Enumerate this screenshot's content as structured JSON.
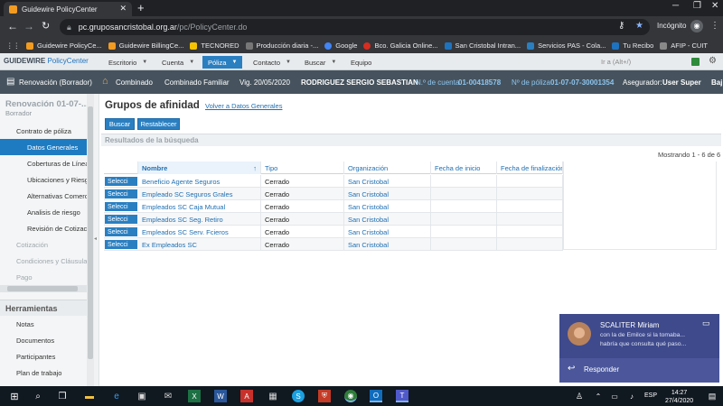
{
  "browser": {
    "tab_title": "Guidewire PolicyCenter",
    "url_host": "pc.gruposancristobal.org.ar",
    "url_path": "/pc/PolicyCenter.do",
    "incognito_label": "Incógnito",
    "bookmarks": [
      {
        "label": "Guidewire PolicyCe...",
        "color": "#f29b21"
      },
      {
        "label": "Guidewire BillingCe...",
        "color": "#f29b21"
      },
      {
        "label": "TECNORED",
        "color": "#f5c400"
      },
      {
        "label": "Producción diaria -...",
        "color": "#3a3a3a"
      },
      {
        "label": "Google",
        "color": "#4285f4"
      },
      {
        "label": "Bco. Galicia Online...",
        "color": "#d62d20"
      },
      {
        "label": "San Cristobal Intran...",
        "color": "#1e73be"
      },
      {
        "label": "Servicios PAS - Cola...",
        "color": "#2a7fc1"
      },
      {
        "label": "Tu Recibo",
        "color": "#1e73be"
      },
      {
        "label": "AFIP - CUIT",
        "color": "#888888"
      }
    ]
  },
  "app": {
    "logo_brand": "GUIDEWIRE",
    "logo_product": "PolicyCenter",
    "menu": [
      {
        "label": "Escritorio"
      },
      {
        "label": "Cuenta"
      },
      {
        "label": "Póliza",
        "selected": true
      },
      {
        "label": "Contacto"
      },
      {
        "label": "Buscar"
      },
      {
        "label": "Equipo"
      }
    ],
    "search_placeholder": "Ir a (Alt+/)",
    "info": {
      "renewal": "Renovación (Borrador)",
      "product": "Combinado",
      "product_type": "Combinado Familiar",
      "effective": "Vig. 20/05/2020",
      "insured": "RODRIGUEZ SERGIO SEBASTIAN",
      "account_label": "N.º de cuenta",
      "account_number": "01-00418578",
      "policy_label": "Nº de póliza",
      "policy_number": "01-07-07-30001354",
      "underwriter_label": "Asegurador:",
      "underwriter": "User Super",
      "extra": "Baj"
    }
  },
  "sidebar": {
    "title": "Renovación 01-07-...",
    "subtitle": "Borrador",
    "items": [
      {
        "label": "Contrato de póliza",
        "indent": 1
      },
      {
        "label": "Datos Generales",
        "indent": 2,
        "selected": true
      },
      {
        "label": "Coberturas de Línea",
        "indent": 2
      },
      {
        "label": "Ubicaciones y Riesgo",
        "indent": 2
      },
      {
        "label": "Alternativas Comerci",
        "indent": 2
      },
      {
        "label": "Analisis de riesgo",
        "indent": 2
      },
      {
        "label": "Revisión de Cotizació",
        "indent": 2
      },
      {
        "label": "Cotización",
        "indent": 1,
        "dim": true
      },
      {
        "label": "Condiciones y Cláusulas",
        "indent": 1,
        "dim": true
      },
      {
        "label": "Pago",
        "indent": 1,
        "dim": true
      }
    ],
    "tools_heading": "Herramientas",
    "tools": [
      "Notas",
      "Documentos",
      "Participantes",
      "Plan de trabajo"
    ]
  },
  "main": {
    "title": "Grupos de afinidad",
    "back_link": "Volver a Datos Generales",
    "buttons": [
      "Buscar",
      "Restablecer"
    ],
    "results_heading": "Resultados de la búsqueda",
    "showing": "Mostrando 1 - 6 de 6",
    "columns": [
      "Nombre",
      "Tipo",
      "Organización",
      "Fecha de inicio",
      "Fecha de finalización"
    ],
    "select_label": "Selecci",
    "rows": [
      [
        "Beneficio Agente Seguros",
        "Cerrado",
        "San Cristobal",
        "",
        ""
      ],
      [
        "Empleado SC Seguros Grales",
        "Cerrado",
        "San Cristobal",
        "",
        ""
      ],
      [
        "Empleados SC Caja Mutual",
        "Cerrado",
        "San Cristobal",
        "",
        ""
      ],
      [
        "Empleados SC Seg. Retiro",
        "Cerrado",
        "San Cristobal",
        "",
        ""
      ],
      [
        "Empleados SC Serv. Fcieros",
        "Cerrado",
        "San Cristobal",
        "",
        ""
      ],
      [
        "Ex Empleados SC",
        "Cerrado",
        "San Cristobal",
        "",
        ""
      ]
    ]
  },
  "chat": {
    "name": "SCALITER Miriam",
    "line1": "con la de Emilce si la tomaba...",
    "line2": "habría que consulta qué paso...",
    "reply": "Responder"
  },
  "taskbar": {
    "lang": "ESP",
    "time": "14:27",
    "date": "27/4/2020"
  }
}
